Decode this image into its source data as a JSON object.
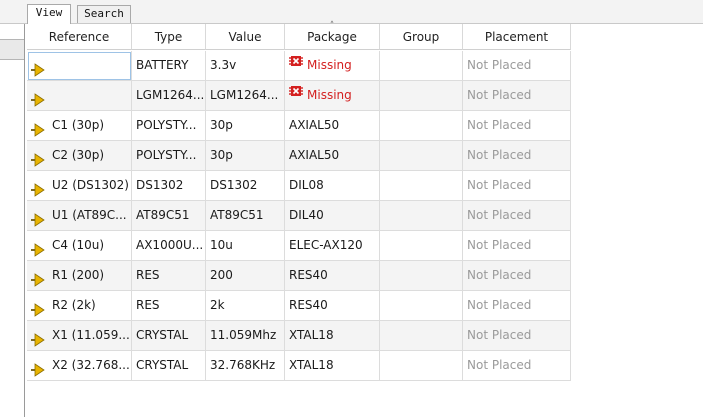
{
  "tabs": [
    {
      "label": "View",
      "active": true
    },
    {
      "label": "Search",
      "active": false
    }
  ],
  "columns": [
    "Reference",
    "Type",
    "Value",
    "Package",
    "Group",
    "Placement"
  ],
  "sorted_column": "Package",
  "rows": [
    {
      "reference": "",
      "type": "BATTERY",
      "value": "3.3v",
      "package": "Missing",
      "package_missing": true,
      "group": "",
      "placement": "Not Placed"
    },
    {
      "reference": "",
      "type": "LGM1264...",
      "value": "LGM1264...",
      "package": "Missing",
      "package_missing": true,
      "group": "",
      "placement": "Not Placed"
    },
    {
      "reference": "C1 (30p)",
      "type": "POLYSTY...",
      "value": "30p",
      "package": "AXIAL50",
      "package_missing": false,
      "group": "",
      "placement": "Not Placed"
    },
    {
      "reference": "C2 (30p)",
      "type": "POLYSTY...",
      "value": "30p",
      "package": "AXIAL50",
      "package_missing": false,
      "group": "",
      "placement": "Not Placed"
    },
    {
      "reference": "U2 (DS1302)",
      "type": "DS1302",
      "value": "DS1302",
      "package": "DIL08",
      "package_missing": false,
      "group": "",
      "placement": "Not Placed"
    },
    {
      "reference": "U1 (AT89C...",
      "type": "AT89C51",
      "value": "AT89C51",
      "package": "DIL40",
      "package_missing": false,
      "group": "",
      "placement": "Not Placed"
    },
    {
      "reference": "C4 (10u)",
      "type": "AX1000U...",
      "value": "10u",
      "package": "ELEC-AX120",
      "package_missing": false,
      "group": "",
      "placement": "Not Placed"
    },
    {
      "reference": "R1 (200)",
      "type": "RES",
      "value": "200",
      "package": "RES40",
      "package_missing": false,
      "group": "",
      "placement": "Not Placed"
    },
    {
      "reference": "R2 (2k)",
      "type": "RES",
      "value": "2k",
      "package": "RES40",
      "package_missing": false,
      "group": "",
      "placement": "Not Placed"
    },
    {
      "reference": "X1 (11.059...",
      "type": "CRYSTAL",
      "value": "11.059Mhz",
      "package": "XTAL18",
      "package_missing": false,
      "group": "",
      "placement": "Not Placed"
    },
    {
      "reference": "X2 (32.768...",
      "type": "CRYSTAL",
      "value": "32.768KHz",
      "package": "XTAL18",
      "package_missing": false,
      "group": "",
      "placement": "Not Placed"
    }
  ],
  "colors": {
    "missing": "#d42020",
    "not_placed": "#9a9a9a",
    "component_icon": "#e8b400"
  },
  "icons": {
    "reference": "component-arrow-icon",
    "missing": "missing-package-icon"
  }
}
